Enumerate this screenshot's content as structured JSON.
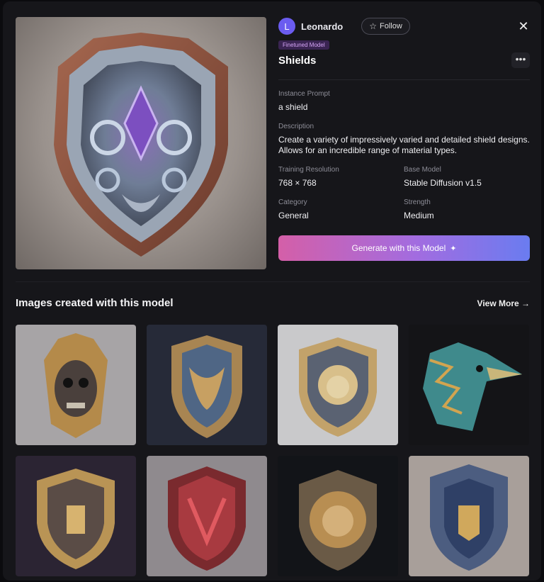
{
  "owner": {
    "initial": "L",
    "name": "Leonardo"
  },
  "follow_label": "Follow",
  "close_icon": "close-icon",
  "badge": "Finetuned Model",
  "model_title": "Shields",
  "more_label": "•••",
  "instance_prompt": {
    "label": "Instance Prompt",
    "value": "a shield"
  },
  "description": {
    "label": "Description",
    "value": "Create a variety of impressively varied and detailed shield designs. Allows for an incredible range of material types."
  },
  "training_resolution": {
    "label": "Training Resolution",
    "value": "768 × 768"
  },
  "base_model": {
    "label": "Base Model",
    "value": "Stable Diffusion v1.5"
  },
  "category": {
    "label": "Category",
    "value": "General"
  },
  "strength": {
    "label": "Strength",
    "value": "Medium"
  },
  "generate_label": "Generate with this Model",
  "gallery": {
    "title": "Images created with this model",
    "view_more": "View More →",
    "images": [
      "skull-helmet",
      "dragon-shield-blue",
      "lion-crest-shield",
      "teal-bird-head",
      "gold-ornate-shield",
      "red-dragon-shield",
      "gold-lion-shield",
      "blue-crest-shield"
    ]
  },
  "colors": {
    "accent_gradient": [
      "#d45fa8",
      "#6a7cf0"
    ],
    "badge": "#d6a6f6",
    "avatar": "#6b5cf0"
  }
}
